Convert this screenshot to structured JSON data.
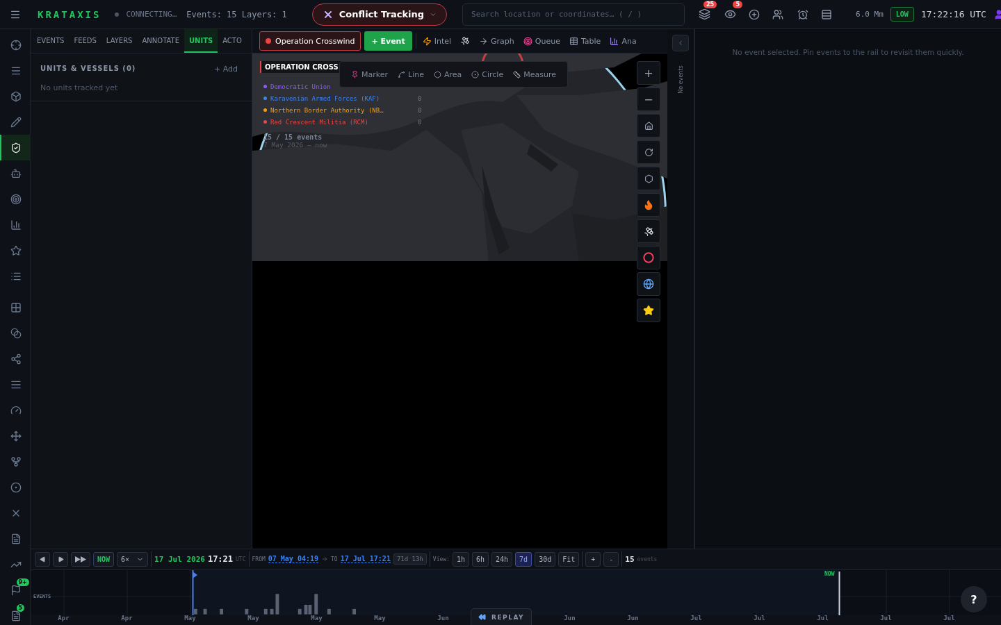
{
  "topbar": {
    "brand": "KRATAXIS",
    "connection": "CONNECTING…",
    "stats": "Events: 15 Layers: 1",
    "mode": "Conflict Tracking",
    "search": {
      "placeholder": "Search location or coordinates… ( / )"
    },
    "badges": [
      "25",
      "5"
    ],
    "scale": "6.0 Mm",
    "threat": "LOW",
    "clock": "17:22:16 UTC"
  },
  "rail": [
    {
      "selected": false
    },
    {
      "selected": false
    },
    {
      "selected": false
    },
    {
      "selected": false
    },
    {
      "selected": true
    },
    {
      "selected": false
    },
    {
      "selected": false
    },
    {
      "selected": false
    },
    {
      "selected": false
    },
    {
      "selected": false
    },
    {
      "selected": false
    },
    {
      "selected": false
    },
    {
      "selected": false
    },
    {
      "selected": false
    },
    {
      "selected": false
    },
    {
      "selected": false
    },
    {
      "selected": false
    },
    {
      "selected": false
    },
    {
      "selected": false
    },
    {
      "selected": false
    },
    {
      "selected": false
    },
    {
      "selected": false,
      "badge": "9+"
    },
    {
      "selected": false,
      "badge": "5"
    }
  ],
  "tabs": [
    {
      "label": "EVENTS",
      "selected": false
    },
    {
      "label": "FEEDS",
      "selected": false
    },
    {
      "label": "LAYERS",
      "selected": false
    },
    {
      "label": "ANNOTATE",
      "selected": false
    },
    {
      "label": "UNITS",
      "selected": true
    },
    {
      "label": "ACTO",
      "selected": false
    }
  ],
  "panel": {
    "title": "UNITS & VESSELS (0)",
    "action": "+ Add",
    "empty": "No units tracked yet"
  },
  "map_toolbar": {
    "operation": "Operation Crosswind",
    "add_event": "+ Event",
    "items": [
      "Intel",
      "Graph",
      "Queue",
      "Table",
      "Ana"
    ]
  },
  "legend": {
    "title": "OPERATION CROSS",
    "factions": [
      {
        "name": "Democratic Union",
        "color": "#8b5cf6"
      },
      {
        "name": "Karavenian Armed Forces (KAF)",
        "color": "#3b82f6",
        "count": "0"
      },
      {
        "name": "Northern Border Authority (NB…",
        "color": "#f59e0b",
        "count": "0"
      },
      {
        "name": "Red Crescent Militia (RCM)",
        "color": "#ef4444",
        "count": "0"
      }
    ],
    "summary": "15 / 15 events",
    "range": "7 May 2026 – now"
  },
  "draw_tools": [
    "Marker",
    "Line",
    "Area",
    "Circle",
    "Measure"
  ],
  "map_controls": {
    "zoom_in": "+",
    "zoom_out": "−"
  },
  "side_rail": {
    "empty": "No events"
  },
  "detail": {
    "empty": "No event selected. Pin events to the rail to revisit them quickly."
  },
  "timeline": {
    "now": "NOW",
    "speed": "6×",
    "date": "17 Jul 2026",
    "time": "17:21",
    "tz": "UTC",
    "from_label": "FROM",
    "from": "07 May 04:19",
    "to_label": "TO",
    "to": "17 Jul 17:21",
    "span": "71d 13h",
    "view_label": "View:",
    "views": [
      {
        "label": "1h",
        "selected": false
      },
      {
        "label": "6h",
        "selected": false
      },
      {
        "label": "24h",
        "selected": false
      },
      {
        "label": "7d",
        "selected": true
      },
      {
        "label": "30d",
        "selected": false
      },
      {
        "label": "Fit",
        "selected": false
      }
    ],
    "zoom": [
      "+",
      "-"
    ],
    "count": "15",
    "count_label": "events",
    "track_label": "EVENTS",
    "now_marker": "NOW",
    "axis": [
      "Apr",
      "Apr",
      "May",
      "May",
      "May",
      "May",
      "Jun",
      "Jun",
      "Jun",
      "Jul",
      "Jul",
      "Jul",
      "Jul",
      "Jul"
    ],
    "replay": "REPLAY",
    "help": "?"
  }
}
